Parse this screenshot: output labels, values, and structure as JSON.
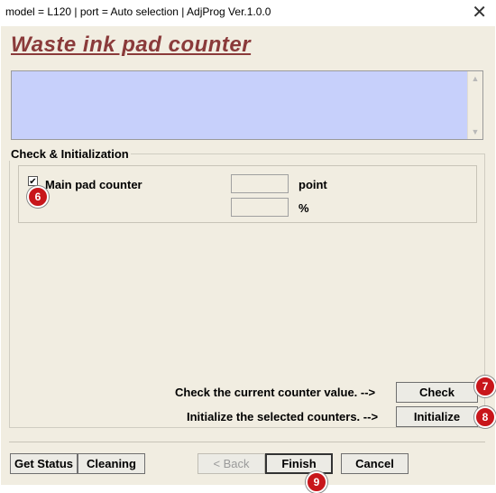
{
  "window": {
    "title": "model = L120 | port = Auto selection | AdjProg Ver.1.0.0",
    "close_glyph": "✕"
  },
  "header": {
    "title": "Waste ink pad counter"
  },
  "message_box": {
    "text": ""
  },
  "group": {
    "legend": "Check & Initialization",
    "counters": [
      {
        "label": "Main pad counter",
        "checked": true,
        "point_value": "",
        "percent_value": "",
        "point_unit": "point",
        "percent_unit": "%"
      }
    ],
    "check_prompt": "Check the current counter value. -->",
    "initialize_prompt": "Initialize the selected counters. -->",
    "check_label": "Check",
    "initialize_label": "Initialize"
  },
  "footer": {
    "get_status_label": "Get Status",
    "cleaning_label": "Cleaning",
    "back_label": "< Back",
    "finish_label": "Finish",
    "cancel_label": "Cancel"
  },
  "annotations": [
    "6",
    "7",
    "8",
    "9"
  ],
  "colors": {
    "heading": "#8a3a3a",
    "message_box_bg": "#c7d0fb",
    "window_bg": "#f1ede1",
    "badge": "#c8161b"
  }
}
